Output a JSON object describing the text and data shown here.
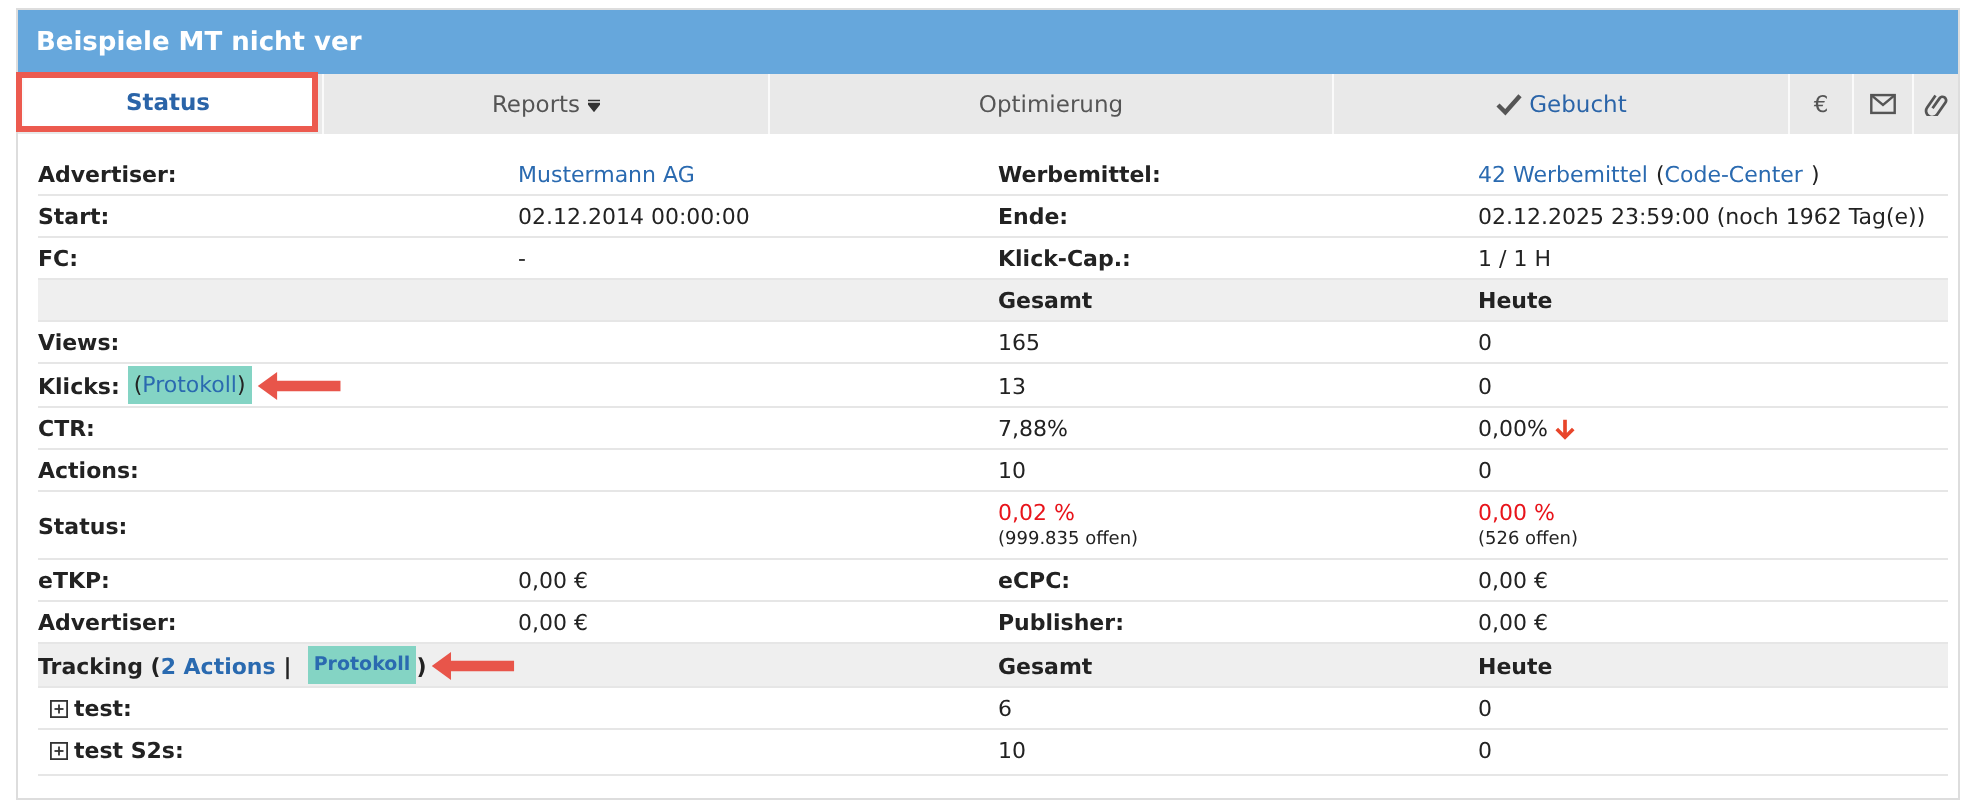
{
  "panel": {
    "title": "Beispiele MT nicht ver"
  },
  "tabs": [
    {
      "kind": "text",
      "label": "Status",
      "selected": true,
      "outlined": true
    },
    {
      "kind": "dropdown",
      "label": "Reports",
      "selected": false,
      "outlined": false
    },
    {
      "kind": "text",
      "label": "Optimierung",
      "selected": false,
      "outlined": false
    },
    {
      "kind": "checked",
      "label": "Gebucht",
      "selected": false,
      "outlined": false
    },
    {
      "kind": "text",
      "label": "€",
      "selected": false,
      "outlined": false
    },
    {
      "kind": "mail",
      "selected": false,
      "outlined": false
    },
    {
      "kind": "paperclip",
      "selected": false,
      "outlined": false
    }
  ],
  "rows": [
    {
      "shaded": false,
      "cells": [
        [
          {
            "kind": "label",
            "text": "Advertiser:"
          }
        ],
        [
          {
            "kind": "link",
            "text": "Mustermann AG"
          }
        ],
        [
          {
            "kind": "label",
            "text": "Werbemittel:"
          }
        ],
        [
          {
            "kind": "link",
            "text": "42 Werbemittel"
          },
          {
            "kind": "text",
            "text": "("
          },
          {
            "kind": "link",
            "text": "Code-Center"
          },
          {
            "kind": "text",
            "text": ")"
          }
        ]
      ]
    },
    {
      "shaded": false,
      "cells": [
        [
          {
            "kind": "label",
            "text": "Start:"
          }
        ],
        [
          {
            "kind": "text",
            "text": "02.12.2014 00:00:00"
          }
        ],
        [
          {
            "kind": "label",
            "text": "Ende:"
          }
        ],
        [
          {
            "kind": "text",
            "text": "02.12.2025 23:59:00 (noch 1962 Tag(e))"
          }
        ]
      ]
    },
    {
      "shaded": false,
      "cells": [
        [
          {
            "kind": "label",
            "text": "FC:"
          }
        ],
        [
          {
            "kind": "text",
            "text": "-"
          }
        ],
        [
          {
            "kind": "label",
            "text": "Klick-Cap.:"
          }
        ],
        [
          {
            "kind": "text",
            "text": "1 / 1 H"
          }
        ]
      ]
    },
    {
      "shaded": true,
      "cells": [
        [],
        [],
        [
          {
            "kind": "label",
            "text": "Gesamt"
          }
        ],
        [
          {
            "kind": "label",
            "text": "Heute"
          }
        ]
      ]
    },
    {
      "shaded": false,
      "cells": [
        [
          {
            "kind": "label",
            "text": "Views:"
          }
        ],
        [],
        [
          {
            "kind": "text",
            "text": "165"
          }
        ],
        [
          {
            "kind": "text",
            "text": "0"
          }
        ]
      ]
    },
    {
      "shaded": false,
      "cells": [
        [
          {
            "kind": "label",
            "text": "Klicks:"
          },
          {
            "kind": "marked",
            "annotated": true,
            "parts": [
              {
                "kind": "text",
                "text": "("
              },
              {
                "kind": "link",
                "text": "Protokoll"
              },
              {
                "kind": "text",
                "text": ")"
              }
            ]
          }
        ],
        [],
        [
          {
            "kind": "text",
            "text": "13"
          }
        ],
        [
          {
            "kind": "text",
            "text": "0"
          }
        ]
      ]
    },
    {
      "shaded": false,
      "cells": [
        [
          {
            "kind": "label",
            "text": "CTR:"
          }
        ],
        [],
        [
          {
            "kind": "text",
            "text": "7,88%"
          }
        ],
        [
          {
            "kind": "text",
            "text": "0,00%",
            "trend_down": true
          }
        ]
      ]
    },
    {
      "shaded": false,
      "cells": [
        [
          {
            "kind": "label",
            "text": "Actions:"
          }
        ],
        [],
        [
          {
            "kind": "text",
            "text": "10"
          }
        ],
        [
          {
            "kind": "text",
            "text": "0"
          }
        ]
      ]
    },
    {
      "shaded": false,
      "cells": [
        [
          {
            "kind": "label",
            "text": "Status:"
          }
        ],
        [],
        [
          {
            "kind": "red",
            "text": "0,02 %"
          },
          {
            "kind": "note",
            "text": "(999.835 offen)"
          }
        ],
        [
          {
            "kind": "red",
            "text": "0,00 %"
          },
          {
            "kind": "note",
            "text": "(526 offen)"
          }
        ]
      ]
    },
    {
      "shaded": false,
      "cells": [
        [
          {
            "kind": "label",
            "text": "eTKP:"
          }
        ],
        [
          {
            "kind": "text",
            "text": "0,00 €"
          }
        ],
        [
          {
            "kind": "label",
            "text": "eCPC:"
          }
        ],
        [
          {
            "kind": "text",
            "text": "0,00 €"
          }
        ]
      ]
    },
    {
      "shaded": false,
      "cells": [
        [
          {
            "kind": "label",
            "text": "Advertiser:"
          }
        ],
        [
          {
            "kind": "text",
            "text": "0,00 €"
          }
        ],
        [
          {
            "kind": "label",
            "text": "Publisher:"
          }
        ],
        [
          {
            "kind": "text",
            "text": "0,00 €"
          }
        ]
      ]
    },
    {
      "shaded": true,
      "cells": [
        [
          {
            "kind": "label",
            "text": "Tracking ("
          },
          {
            "kind": "link_bold",
            "text": "2 Actions"
          },
          {
            "kind": "label",
            "text": "|"
          },
          {
            "kind": "marked",
            "annotated": false,
            "parts": [
              {
                "kind": "link_small",
                "text": "Protokoll"
              }
            ]
          },
          {
            "kind": "label",
            "text": ")",
            "annotated": true
          }
        ],
        [],
        [
          {
            "kind": "label",
            "text": "Gesamt"
          }
        ],
        [
          {
            "kind": "label",
            "text": "Heute"
          }
        ]
      ]
    },
    {
      "shaded": false,
      "expanded": false,
      "cells": [
        [
          {
            "kind": "label",
            "text": "test:"
          }
        ],
        [],
        [
          {
            "kind": "text",
            "text": "6"
          }
        ],
        [
          {
            "kind": "text",
            "text": "0"
          }
        ]
      ]
    },
    {
      "shaded": false,
      "expanded": false,
      "cells": [
        [
          {
            "kind": "label",
            "text": "test S2s:"
          }
        ],
        [],
        [
          {
            "kind": "text",
            "text": "10"
          }
        ],
        [
          {
            "kind": "text",
            "text": "0"
          }
        ]
      ]
    }
  ]
}
